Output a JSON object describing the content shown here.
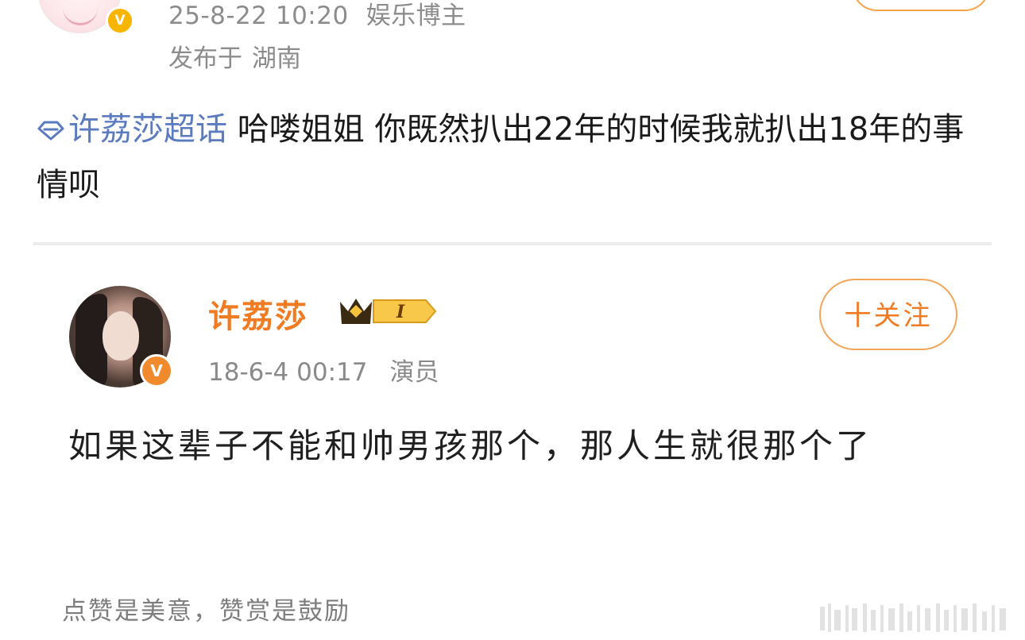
{
  "top_post": {
    "timestamp": "25-8-22 10:20",
    "category": "娱乐博主",
    "published_label": "发布于",
    "location": "湖南",
    "verified_badge": "V"
  },
  "post": {
    "topic_icon": "super-topic-diamond-icon",
    "topic": "许荔莎超话",
    "text": " 哈喽姐姐 你既然扒出22年的时候我就扒出18年的事情呗"
  },
  "quoted": {
    "username": "许荔莎",
    "level_badge": "I",
    "verified_badge": "V",
    "timestamp": "18-6-4 00:17",
    "role": "演员",
    "follow_label": "十关注",
    "text": "如果这辈子不能和帅男孩那个，那人生就很那个了",
    "footer": "点赞是美意，赞赏是鼓励"
  },
  "colors": {
    "accent_orange": "#f07b22",
    "topic_blue": "#5b7bc1",
    "meta_gray": "#8c8c8c",
    "divider": "#ececec"
  }
}
